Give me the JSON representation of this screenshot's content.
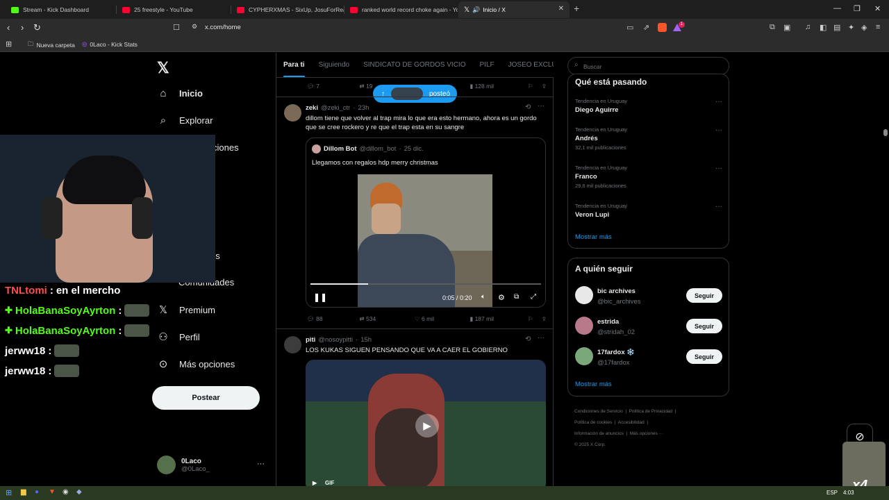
{
  "browser": {
    "tabs": [
      {
        "title": "Stream - Kick Dashboard",
        "color": "#53fc18"
      },
      {
        "title": "25 freestyle - YouTube",
        "color": "#ff0033"
      },
      {
        "title": "CYPHERXMAS - SixUp, JosuForReal, F",
        "color": "#ff0033"
      },
      {
        "title": "ranked world record choke again - Yo",
        "color": "#ff0033"
      },
      {
        "title": "Inicio / X",
        "color": "#ffffff"
      }
    ],
    "url": "x.com/home",
    "bookmarks": [
      "Nueva carpeta",
      "0Laco - Kick Stats"
    ],
    "shield_badge": "1"
  },
  "x": {
    "nav": [
      "Inicio",
      "Explorar",
      "Notificaciones",
      "Comunidades",
      "Premium",
      "Perfil",
      "Más opciones"
    ],
    "nav_partial": {
      "notif_tail": "ciones",
      "items_tail": "os"
    },
    "post_button": "Postear",
    "account": {
      "name": "0Laco",
      "handle": "@0Laco_"
    },
    "feed_tabs": [
      "Para ti",
      "Siguiendo",
      "SINDICATO DE GORDOS VICIO",
      "PILF",
      "JOSEO EXCLUSI"
    ],
    "posted_pill": "posteó",
    "tweet0_actions": {
      "replies": "7",
      "retweets": "19",
      "views": "128 mil"
    },
    "tweet1": {
      "name": "zeki",
      "handle": "@zeki_ctr",
      "time": "23h",
      "text": "dillom tiene que volver al trap mira lo que era esto hermano, ahora es un gordo que se cree rockero y re que el trap esta en su sangre",
      "quote": {
        "name": "Dillom Bot",
        "handle": "@dillom_bot",
        "time": "25 dic.",
        "text": "Llegamos con regalos hdp merry christmas"
      },
      "video_time": "0:05 / 0:20",
      "video_progress": 0.25,
      "actions": {
        "replies": "88",
        "retweets": "534",
        "likes": "6 mil",
        "views": "187 mil"
      }
    },
    "tweet2": {
      "name": "piti",
      "handle": "@nosoypitti",
      "time": "15h",
      "text": "LOS KUKAS SIGUEN PENSANDO QUE VA A CAER EL GOBIERNO",
      "gif_label": "GIF"
    },
    "search_placeholder": "Buscar",
    "trends_title": "Qué está pasando",
    "trends": [
      {
        "meta": "Tendencia en Uruguay",
        "name": "Diego Aguirre",
        "count": ""
      },
      {
        "meta": "Tendencia en Uruguay",
        "name": "Andrés",
        "count": "32,1 mil publicaciones"
      },
      {
        "meta": "Tendencia en Uruguay",
        "name": "Franco",
        "count": "29,6 mil publicaciones"
      },
      {
        "meta": "Tendencia en Uruguay",
        "name": "Veron Lupi",
        "count": ""
      }
    ],
    "show_more": "Mostrar más",
    "who_to_follow": "A quién seguir",
    "follow_suggestions": [
      {
        "name": "bic archives",
        "handle": "@bic_archives"
      },
      {
        "name": "estrida",
        "handle": "@stridah_02"
      },
      {
        "name": "17fardox ❄️",
        "handle": "@17fardox"
      }
    ],
    "follow_label": "Seguir",
    "footer": [
      "Condiciones de Servicio",
      "Política de Privacidad",
      "Política de cookies",
      "Accesibilidad",
      "Información de anuncios",
      "Más opciones ···",
      "© 2025 X Corp."
    ]
  },
  "stream_overlay": {
    "chat": [
      {
        "user": "TNLtomi",
        "user_color": "#ff4d4d",
        "msg": "en el mercho",
        "emote": false,
        "badge": false
      },
      {
        "user": "HolaBanaSoyAyrton",
        "user_color": "#53fc18",
        "msg": "",
        "emote": true,
        "badge": true
      },
      {
        "user": "HolaBanaSoyAyrton",
        "user_color": "#53fc18",
        "msg": "",
        "emote": true,
        "badge": true
      },
      {
        "user": "jerww18",
        "user_color": "#ffffff",
        "msg": "",
        "emote": true,
        "badge": false
      },
      {
        "user": "jerww18",
        "user_color": "#ffffff",
        "msg": "",
        "emote": true,
        "badge": false
      }
    ],
    "corner_text": "x4"
  },
  "taskbar": {
    "lang": "ESP",
    "time": "4:03"
  }
}
